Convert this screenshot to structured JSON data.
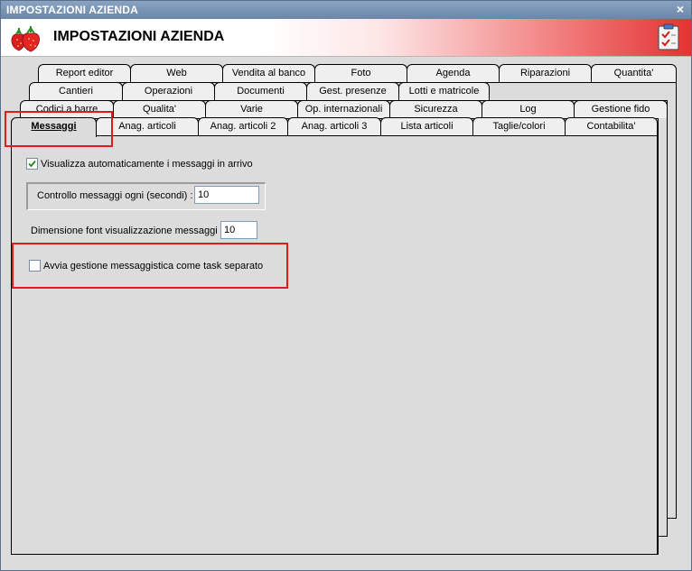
{
  "window": {
    "title": "IMPOSTAZIONI AZIENDA",
    "close_glyph": "×"
  },
  "banner": {
    "title": "IMPOSTAZIONI AZIENDA",
    "logo_icon": "strawberry-icon",
    "checklist_icon": "checklist-icon"
  },
  "tabs": {
    "row1": [
      "Report editor",
      "Web",
      "Vendita al banco",
      "Foto",
      "Agenda",
      "Riparazioni",
      "Quantita'"
    ],
    "row2": [
      "Cantieri",
      "Operazioni",
      "Documenti",
      "Gest. presenze",
      "Lotti e matricole"
    ],
    "row3": [
      "Codici a barre",
      "Qualita'",
      "Varie",
      "Op. internazionali",
      "Sicurezza",
      "Log",
      "Gestione fido"
    ],
    "row4": [
      "Messaggi",
      "Anag. articoli",
      "Anag. articoli 2",
      "Anag. articoli 3",
      "Lista articoli",
      "Taglie/colori",
      "Contabilita'"
    ]
  },
  "form": {
    "auto_show_label": "Visualizza automaticamente i messaggi in arrivo",
    "auto_show_checked": true,
    "check_interval_label": "Controllo messaggi ogni (secondi) :",
    "check_interval_value": "10",
    "font_size_label": "Dimensione font visualizzazione messaggi :",
    "font_size_value": "10",
    "separate_task_label": "Avvia gestione messaggistica come task separato",
    "separate_task_checked": false
  },
  "colors": {
    "highlight": "#e21a1a",
    "banner_red": "#e43232"
  }
}
